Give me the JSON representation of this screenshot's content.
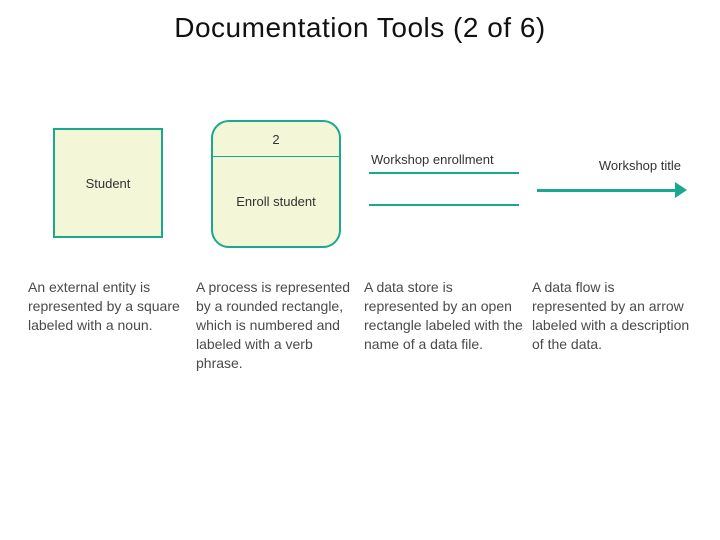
{
  "title": "Documentation Tools (2 of 6)",
  "columns": {
    "entity": {
      "symbol_label": "Student",
      "description": "An external entity is represented by a square labeled with a noun."
    },
    "process": {
      "number": "2",
      "symbol_label": "Enroll student",
      "description": "A process is represented by a rounded rectangle, which is numbered and labeled with a verb phrase."
    },
    "datastore": {
      "symbol_label": "Workshop enrollment",
      "description": "A data store is represented by an open rectangle labeled with the name of a data file."
    },
    "dataflow": {
      "symbol_label": "Workshop title",
      "description": "A data flow is represented by an arrow labeled with a description of the data."
    }
  },
  "colors": {
    "accent": "#1aa890",
    "fill": "#f3f6d7"
  }
}
